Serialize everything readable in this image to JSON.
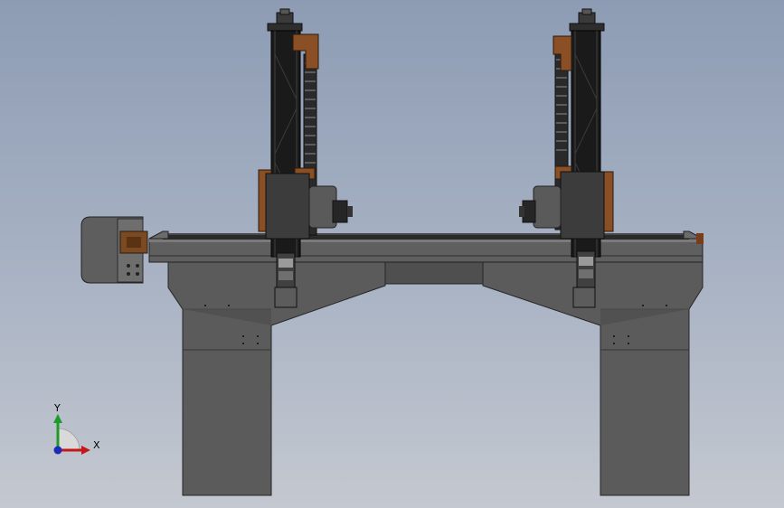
{
  "viewport": {
    "background_top": "#8d9cb4",
    "background_bottom": "#c4c8d0"
  },
  "triad": {
    "x_label": "X",
    "y_label": "Y",
    "x_color": "#c41818",
    "y_color": "#1e9a28",
    "z_color": "#1c2bb8"
  },
  "colors": {
    "concrete": "#5a5a5a",
    "concrete_edge": "#2a2a2a",
    "steel_dark": "#1b1b1b",
    "steel_mid": "#3e3e3e",
    "rust": "#8a4f24"
  }
}
